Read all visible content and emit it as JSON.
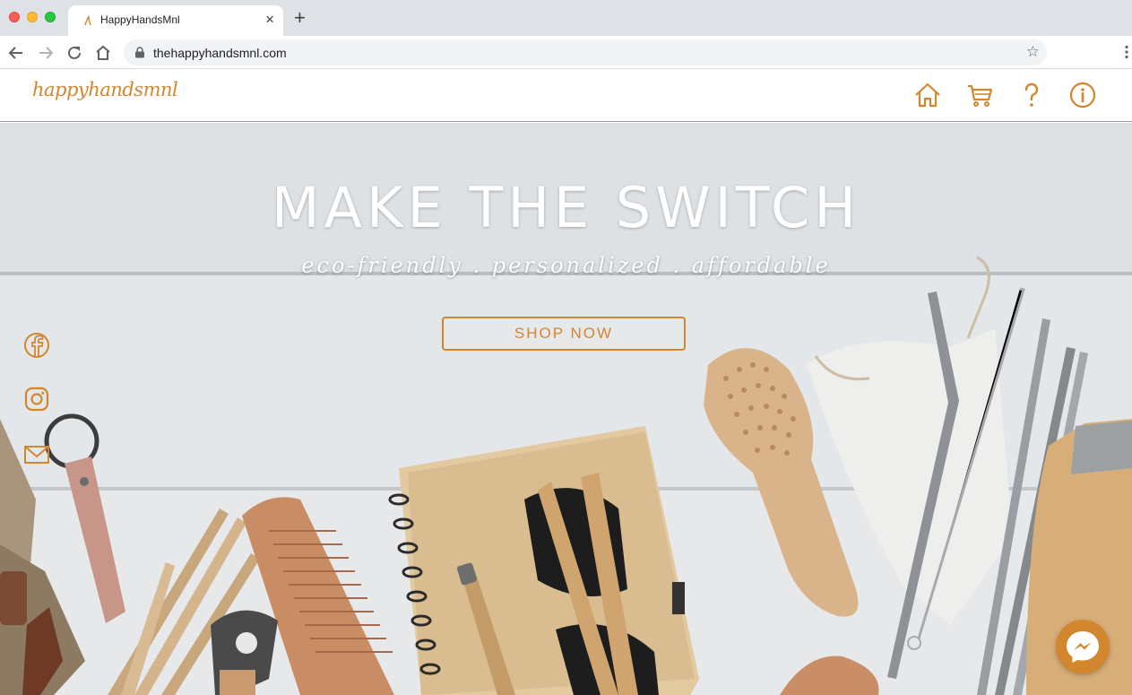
{
  "browser": {
    "tab_title": "HappyHandsMnl",
    "url": "thehappyhandsmnl.com",
    "close_glyph": "×",
    "newtab_glyph": "+",
    "star_glyph": "☆"
  },
  "site": {
    "logo": "happyhandsmnl",
    "nav_icons": [
      "home-icon",
      "cart-icon",
      "question-icon",
      "info-icon"
    ],
    "accent_color": "#d2862d"
  },
  "hero": {
    "title": "MAKE THE SWITCH",
    "subtitle": "eco-friendly . personalized . affordable",
    "cta_label": "SHOP NOW"
  },
  "social_icons": [
    "facebook-icon",
    "instagram-icon",
    "email-icon"
  ],
  "chat_icon": "messenger-icon"
}
